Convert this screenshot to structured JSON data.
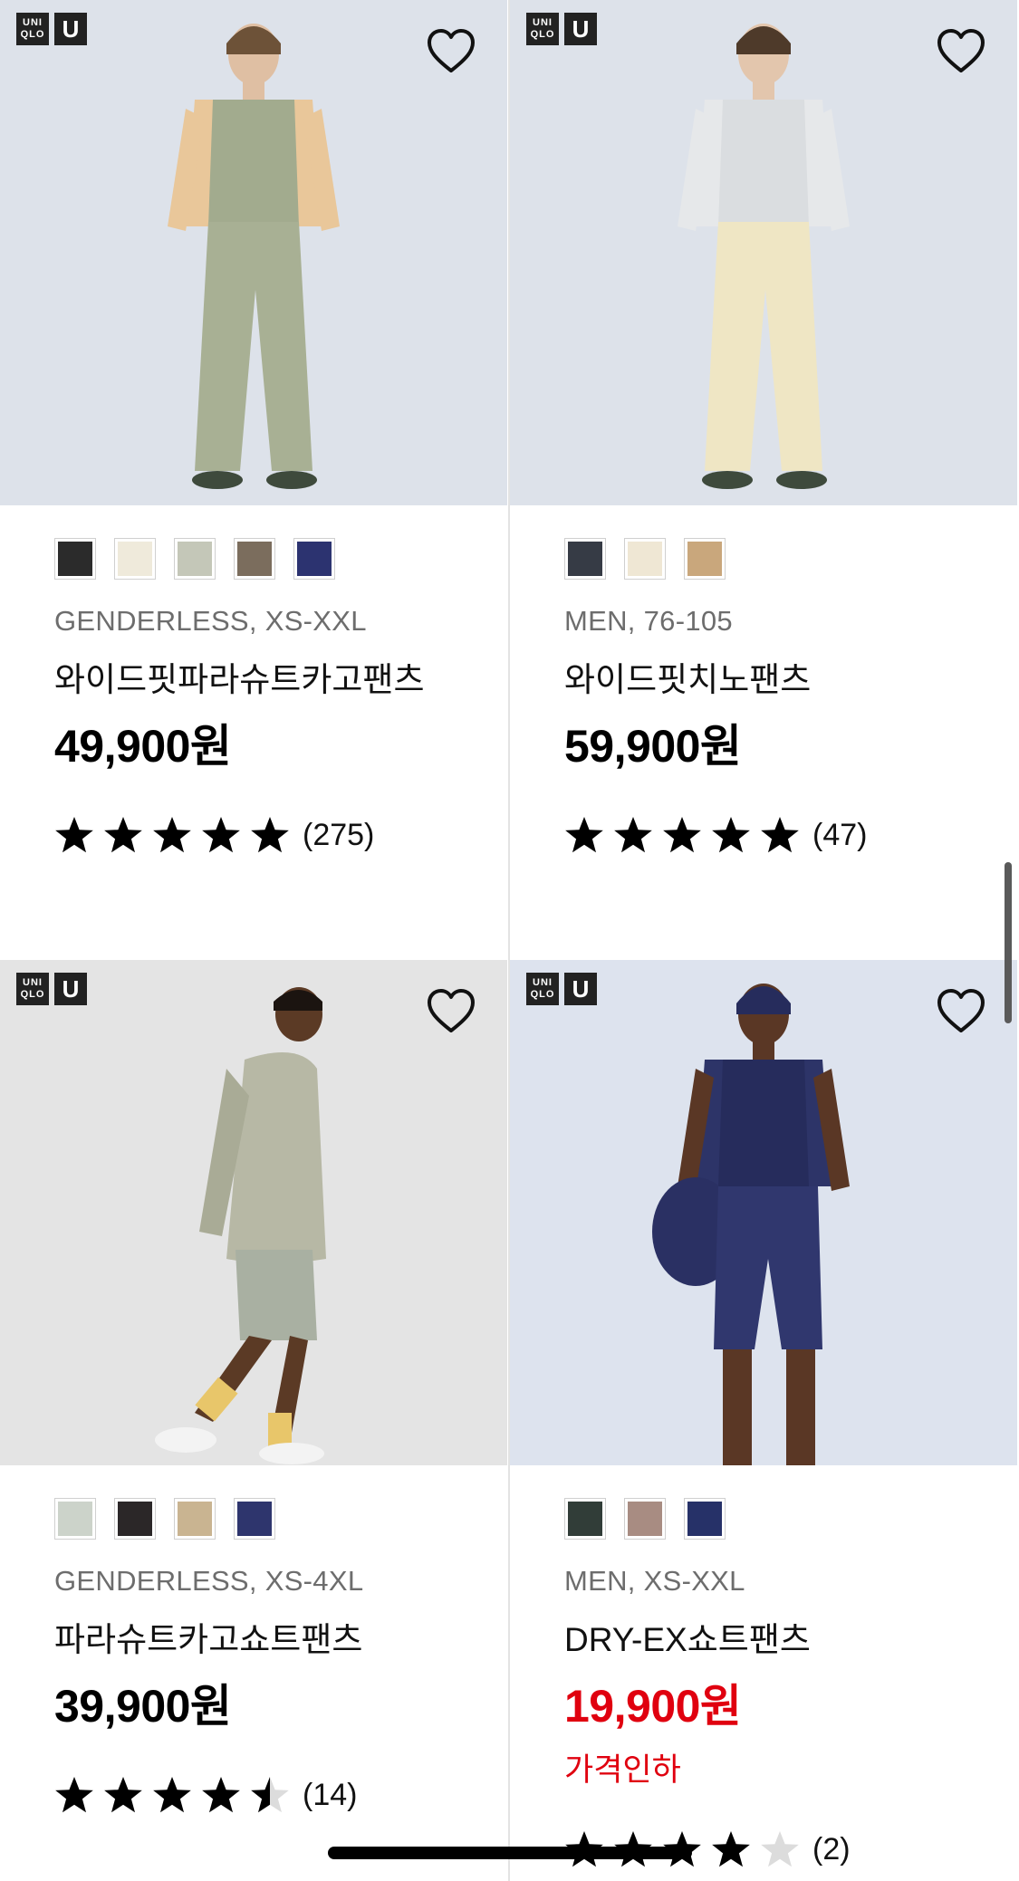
{
  "badges": {
    "uniqlo": "UNI QLO",
    "u": "U"
  },
  "products": [
    {
      "meta": "GENDERLESS, XS-XXL",
      "name": "와이드핏파라슈트카고팬츠",
      "price": "49,900원",
      "sale_label": "",
      "rating": 5,
      "review_count": "(275)",
      "price_color": "#000000",
      "swatches": [
        "#2b2b2b",
        "#efeadb",
        "#c4c7b8",
        "#7b6d5d",
        "#2c3370"
      ],
      "photo": {
        "bg": "#dde2ea",
        "top": "#e9c79a",
        "vest": "#a2ab8e",
        "bottom": "#a8b094",
        "skin": "#dfbfa3",
        "hair": "#6d5238"
      }
    },
    {
      "meta": "MEN, 76-105",
      "name": "와이드핏치노팬츠",
      "price": "59,900원",
      "sale_label": "",
      "rating": 5,
      "review_count": "(47)",
      "price_color": "#000000",
      "swatches": [
        "#363b45",
        "#efe7d4",
        "#c9a77c"
      ],
      "photo": {
        "bg": "#dde2ea",
        "top": "#e6e8ea",
        "vest": "#dadde0",
        "bottom": "#efe6c4",
        "skin": "#e3c6ad",
        "hair": "#4e3a2a"
      }
    },
    {
      "meta": "GENDERLESS, XS-4XL",
      "name": "파라슈트카고쇼트팬츠",
      "price": "39,900원",
      "sale_label": "",
      "rating": 4.5,
      "review_count": "(14)",
      "price_color": "#000000",
      "swatches": [
        "#ccd3ca",
        "#2b2728",
        "#c9b491",
        "#2e356d"
      ],
      "photo": {
        "bg": "#e4e4e4",
        "top": "#b7b8a5",
        "vest": "#a9ab96",
        "bottom": "#a9b0a2",
        "skin": "#5b3a25",
        "hair": "#1b1410"
      }
    },
    {
      "meta": "MEN, XS-XXL",
      "name": "DRY-EX쇼트팬츠",
      "price": "19,900원",
      "sale_label": "가격인하",
      "rating": 4,
      "review_count": "(2)",
      "price_color": "#e0000f",
      "swatches": [
        "#313d38",
        "#a88c82",
        "#263168"
      ],
      "photo": {
        "bg": "#dde3ee",
        "top": "#2d3468",
        "vest": "#262c5c",
        "bottom": "#30376e",
        "skin": "#5a3725",
        "hair": "#262c5c"
      }
    }
  ]
}
